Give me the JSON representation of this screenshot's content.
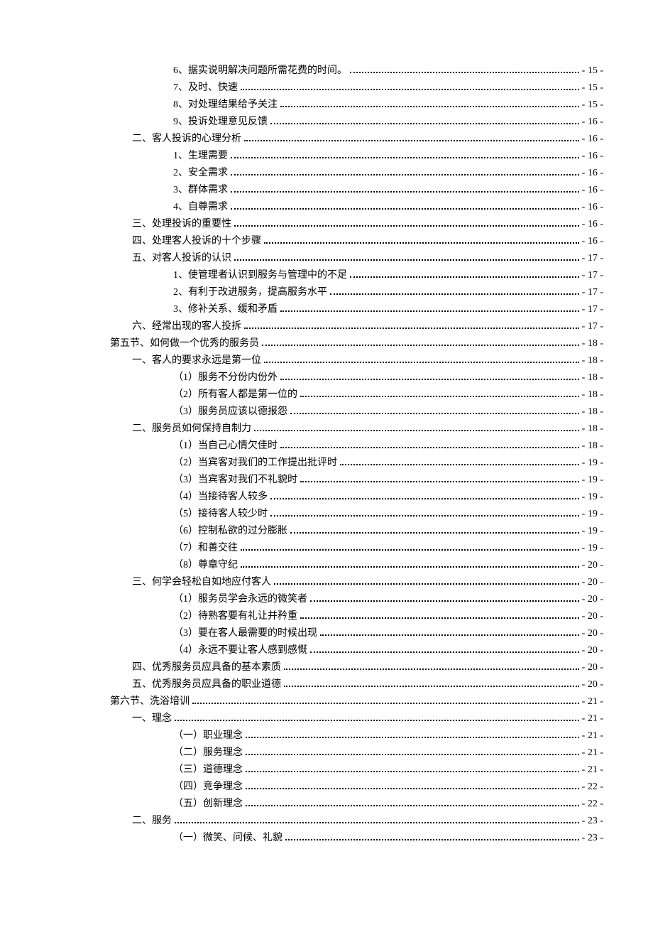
{
  "toc": [
    {
      "indent": 3,
      "title": "6、据实说明解决问题所需花费的时间。",
      "page": "- 15 -"
    },
    {
      "indent": 3,
      "title": "7、及时、快速",
      "page": "- 15 -"
    },
    {
      "indent": 3,
      "title": "8、对处理结果给予关注",
      "page": "- 15 -"
    },
    {
      "indent": 3,
      "title": "9、投诉处理意见反馈",
      "page": "- 16 -"
    },
    {
      "indent": 2,
      "title": "二、客人投诉的心理分析",
      "page": "- 16 -"
    },
    {
      "indent": 3,
      "title": "1、生理需要",
      "page": "- 16 -"
    },
    {
      "indent": 3,
      "title": "2、安全需求",
      "page": "- 16 -"
    },
    {
      "indent": 3,
      "title": "3、群体需求",
      "page": "- 16 -"
    },
    {
      "indent": 3,
      "title": "4、自尊需求",
      "page": "- 16 -"
    },
    {
      "indent": 2,
      "title": "三、处理投诉的重要性",
      "page": "- 16 -"
    },
    {
      "indent": 2,
      "title": "四、处理客人投诉的十个步骤",
      "page": "- 16 -"
    },
    {
      "indent": 2,
      "title": "五、对客人投诉的认识",
      "page": "- 17 -"
    },
    {
      "indent": 3,
      "title": "1、使管理者认识到服务与管理中的不足",
      "page": "- 17 -"
    },
    {
      "indent": 3,
      "title": "2、有利于改进服务，提高服务水平",
      "page": "- 17 -"
    },
    {
      "indent": 3,
      "title": "3、修补关系、缓和矛盾",
      "page": "- 17 -"
    },
    {
      "indent": 2,
      "title": "六、经常出现的客人投拆",
      "page": "- 17 -"
    },
    {
      "indent": 1,
      "title": "第五节、如何做一个优秀的服务员",
      "page": "- 18 -"
    },
    {
      "indent": 2,
      "title": "一、客人的要求永远是第一位",
      "page": "- 18 -"
    },
    {
      "indent": 3,
      "title": "（1）服务不分份内份外",
      "page": "- 18 -"
    },
    {
      "indent": 3,
      "title": "（2）所有客人都是第一位的",
      "page": "- 18 -"
    },
    {
      "indent": 3,
      "title": "（3）服务员应该以德报怨",
      "page": "- 18 -"
    },
    {
      "indent": 2,
      "title": "二、服务员如何保持自制力",
      "page": "- 18 -"
    },
    {
      "indent": 3,
      "title": "（1）当自己心情欠佳时",
      "page": "- 18 -"
    },
    {
      "indent": 3,
      "title": "（2）当宾客对我们的工作提出批评时",
      "page": "- 19 -"
    },
    {
      "indent": 3,
      "title": "（3）当宾客对我们不礼貌时",
      "page": "- 19 -"
    },
    {
      "indent": 3,
      "title": "（4）当接待客人较多",
      "page": "- 19 -"
    },
    {
      "indent": 3,
      "title": "（5）接待客人较少时",
      "page": "- 19 -"
    },
    {
      "indent": 3,
      "title": "（6）控制私欲的过分膨胀",
      "page": "- 19 -"
    },
    {
      "indent": 3,
      "title": "（7）和善交往",
      "page": "- 19 -"
    },
    {
      "indent": 3,
      "title": "（8）尊章守纪",
      "page": "- 20 -"
    },
    {
      "indent": 2,
      "title": "三、何学会轻松自如地应付客人",
      "page": "- 20 -"
    },
    {
      "indent": 3,
      "title": "（1）服务员学会永远的微笑者",
      "page": "- 20 -"
    },
    {
      "indent": 3,
      "title": "（2）待熟客要有礼让并矜重",
      "page": "- 20 -"
    },
    {
      "indent": 3,
      "title": "（3）要在客人最需要的时候出现",
      "page": "- 20 -"
    },
    {
      "indent": 3,
      "title": "（4）永远不要让客人感到感慨",
      "page": "- 20 -"
    },
    {
      "indent": 2,
      "title": "四、优秀服务员应具备的基本素质",
      "page": "- 20 -"
    },
    {
      "indent": 2,
      "title": "五、优秀服务员应具备的职业道德",
      "page": "- 20 -"
    },
    {
      "indent": 1,
      "title": "第六节、洗浴培训",
      "page": "- 21 -"
    },
    {
      "indent": 2,
      "title": "一、理念",
      "page": "- 21 -"
    },
    {
      "indent": 3,
      "title": "（一）职业理念",
      "page": "- 21 -"
    },
    {
      "indent": 3,
      "title": "（二）服务理念",
      "page": "- 21 -"
    },
    {
      "indent": 3,
      "title": "（三）道德理念",
      "page": "- 21 -"
    },
    {
      "indent": 3,
      "title": "（四）竞争理念",
      "page": "- 22 -"
    },
    {
      "indent": 3,
      "title": "（五）创新理念",
      "page": "- 22 -"
    },
    {
      "indent": 2,
      "title": "二、服务",
      "page": "- 23 -"
    },
    {
      "indent": 3,
      "title": "（一）微笑、问候、礼貌",
      "page": "- 23 -"
    }
  ]
}
